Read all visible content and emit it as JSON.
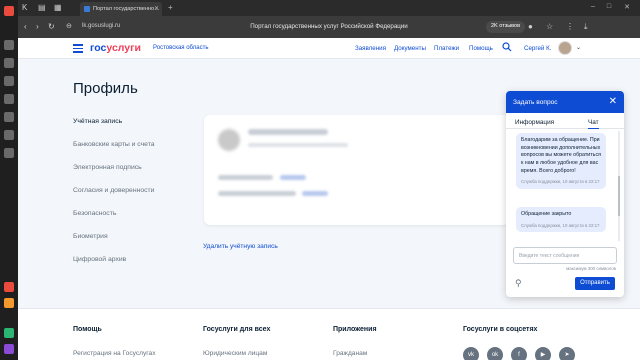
{
  "browser": {
    "tab_title": "Портал государственно…",
    "url": "lk.gosuslugi.ru",
    "page_title": "Портал государственных услуг Российской Федерации",
    "reviews_badge": "2K отзывов"
  },
  "header": {
    "logo_a": "гос",
    "logo_b": "услуги",
    "region": "Ростовская область",
    "nav": [
      "Заявления",
      "Документы",
      "Платежи",
      "Помощь"
    ],
    "user": "Сергей К."
  },
  "main": {
    "title": "Профиль",
    "menu": [
      "Учётная запись",
      "Банковские карты и счета",
      "Электронная подпись",
      "Согласия и доверенности",
      "Безопасность",
      "Биометрия",
      "Цифровой архив"
    ],
    "delete_account": "Удалить учётную запись"
  },
  "footer": {
    "cols": [
      {
        "head": "Помощь",
        "link": "Регистрация на Госуслугах"
      },
      {
        "head": "Госуслуги для всех",
        "link": "Юридическим лицам"
      },
      {
        "head": "Приложения",
        "link": "Гражданам"
      },
      {
        "head": "Госуслуги в соцсетях",
        "link": ""
      }
    ],
    "social": [
      "vk-icon",
      "ok-icon",
      "fb-icon",
      "youtube-icon",
      "telegram-icon"
    ]
  },
  "chat": {
    "title": "Задать вопрос",
    "tabs": [
      "Информация",
      "Чат"
    ],
    "messages": [
      {
        "text": "Благодарим за обращение. При возникновении дополнительных вопросов вы можете обратиться к нам в любое удобное для вас время. Всего доброго!",
        "meta": "Служба поддержки, 10 августа в 22:17"
      },
      {
        "text": "Обращение закрыто",
        "meta": "Служба поддержки, 10 августа в 22:17"
      }
    ],
    "input_placeholder": "Введите текст сообщения",
    "limit": "максимум 300 символов",
    "send_label": "Отправить"
  },
  "colors": {
    "accent": "#0d4cd3",
    "logo_red": "#ee3f58"
  }
}
